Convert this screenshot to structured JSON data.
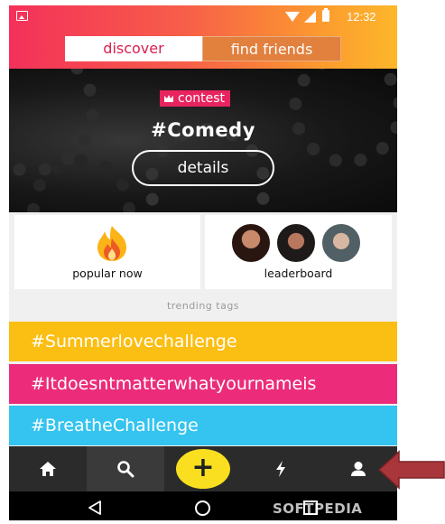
{
  "status_bar": {
    "time": "12:32"
  },
  "tabs": {
    "discover": "discover",
    "find_friends": "find friends"
  },
  "banner": {
    "badge": "contest",
    "title": "#Comedy",
    "details_label": "details"
  },
  "cards": {
    "popular_label": "popular now",
    "leaderboard_label": "leaderboard"
  },
  "trending": {
    "label": "trending tags",
    "tags": [
      "#Summerlovechallenge",
      "#Itdoesntmatterwhatyournameis",
      "#BreatheChallenge"
    ]
  },
  "bottom_nav": {
    "add_label": "+"
  },
  "watermark": "SOFTPEDIA",
  "colors": {
    "accent_pink": "#e8245f",
    "tag_yellow": "#fbbe12",
    "tag_pink": "#ec2c7a",
    "tag_blue": "#34c4ef",
    "add_button": "#f9df1f",
    "callout_arrow": "#a8363a"
  },
  "icons": [
    "gallery-icon",
    "wifi-icon",
    "signal-icon",
    "battery-icon",
    "crown-icon",
    "fire-icon",
    "home-icon",
    "search-icon",
    "add-icon",
    "lightning-icon",
    "profile-icon",
    "back-icon",
    "home-circle-icon",
    "recent-apps-icon"
  ]
}
